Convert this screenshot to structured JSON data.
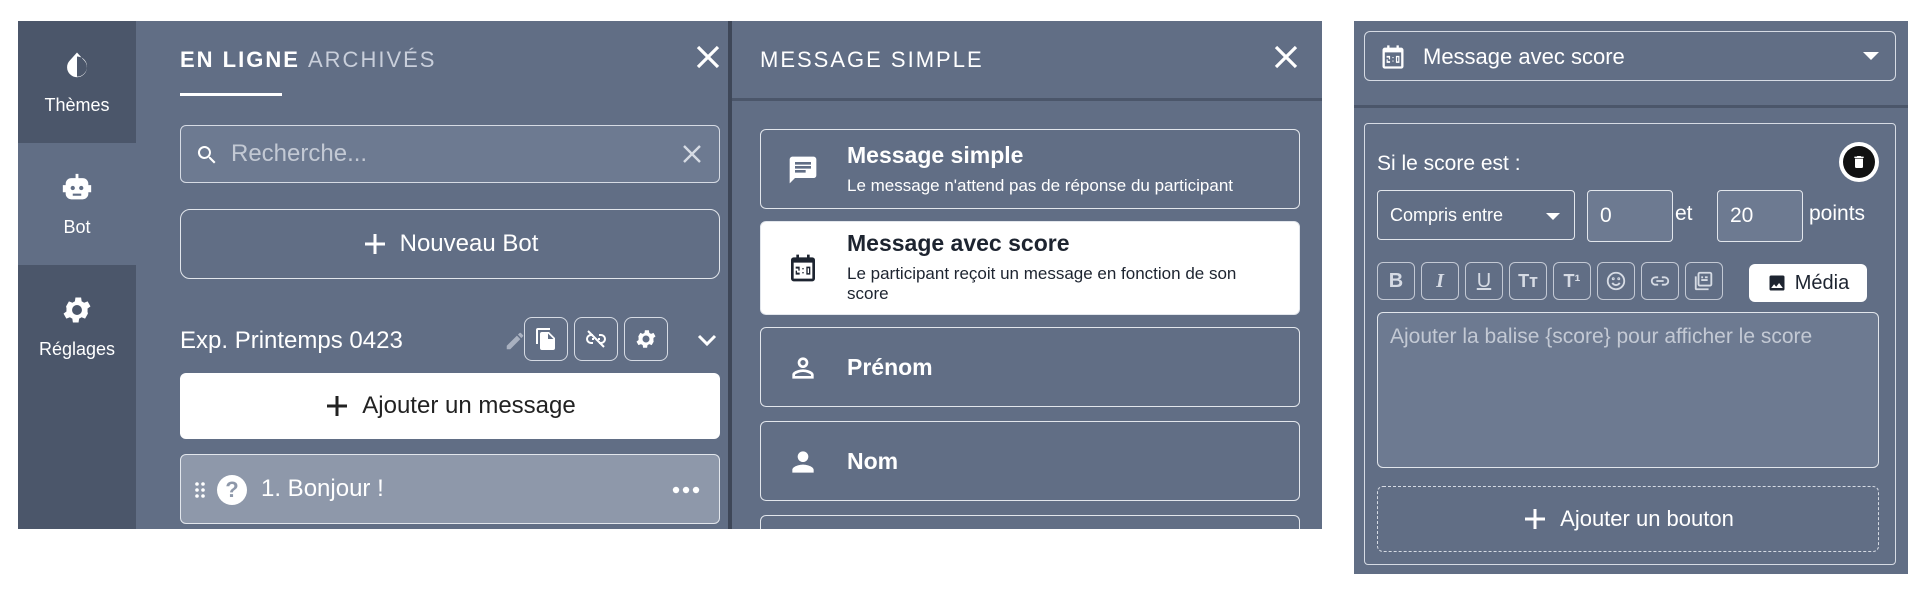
{
  "sidebar": {
    "items": [
      {
        "label": "Thèmes",
        "icon": "theme-drop-icon"
      },
      {
        "label": "Bot",
        "icon": "robot-icon"
      },
      {
        "label": "Réglages",
        "icon": "gear-icon"
      }
    ],
    "active": "Bot"
  },
  "bots_panel": {
    "tabs": [
      "EN LIGNE",
      "ARCHIVÉS"
    ],
    "search_placeholder": "Recherche...",
    "new_bot_label": "Nouveau Bot",
    "bot_name": "Exp. Printemps 0423",
    "add_message_label": "Ajouter un message",
    "messages": [
      {
        "label": "1. Bonjour !"
      }
    ]
  },
  "type_panel": {
    "title": "MESSAGE SIMPLE",
    "types": [
      {
        "title": "Message simple",
        "desc": "Le message n'attend pas de réponse du participant",
        "icon": "chat-icon"
      },
      {
        "title": "Message avec score",
        "desc": "Le participant reçoit un message en fonction de son score",
        "icon": "scoreboard-icon",
        "selected": true
      },
      {
        "title": "Prénom",
        "desc": "",
        "icon": "person-outline-icon"
      },
      {
        "title": "Nom",
        "desc": "",
        "icon": "person-icon"
      }
    ]
  },
  "editor": {
    "type_selected": "Message avec score",
    "condition_label": "Si le score est :",
    "comparison": "Compris entre",
    "min": "0",
    "and_label": "et",
    "max": "20",
    "points_label": "points",
    "media_label": "Média",
    "text_placeholder": "Ajouter la balise {score} pour afficher le score",
    "add_button_label": "Ajouter un bouton"
  }
}
